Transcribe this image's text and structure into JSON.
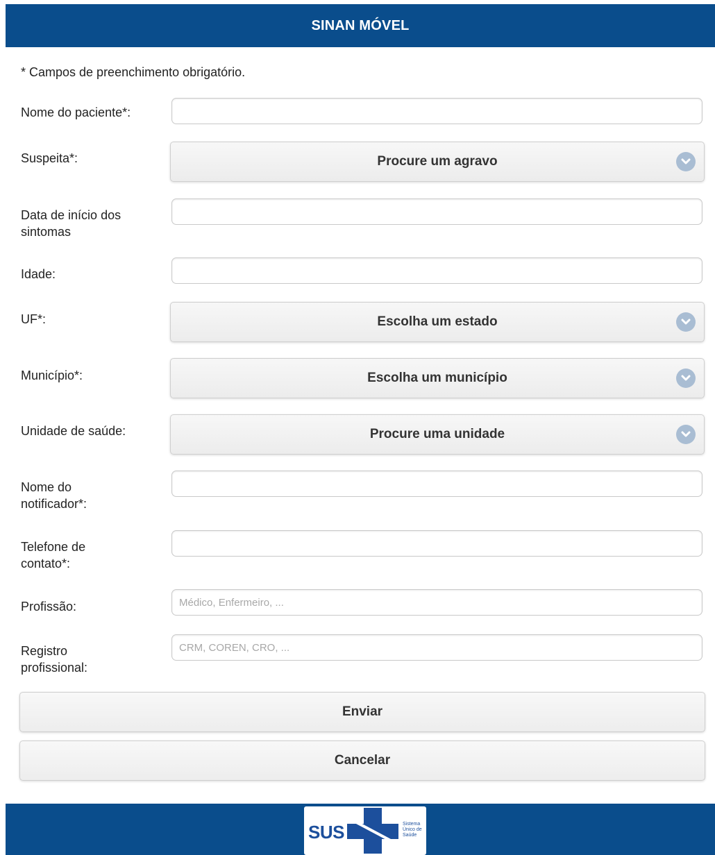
{
  "header": {
    "title": "SINAN MÓVEL"
  },
  "form": {
    "required_note": "* Campos de preenchimento obrigatório.",
    "patient_name": {
      "label": "Nome do paciente*:",
      "value": ""
    },
    "suspicion": {
      "label": "Suspeita*:",
      "selected": "Procure um agravo"
    },
    "symptom_start_date": {
      "label": "Data de início dos sintomas",
      "value": ""
    },
    "age": {
      "label": "Idade:",
      "value": ""
    },
    "state": {
      "label": "UF*:",
      "selected": "Escolha um estado"
    },
    "municipality": {
      "label": "Município*:",
      "selected": "Escolha um município"
    },
    "health_unit": {
      "label": "Unidade de saúde:",
      "selected": "Procure uma unidade"
    },
    "notifier_name": {
      "label": "Nome do notificador*:",
      "value": ""
    },
    "contact_phone": {
      "label": "Telefone de contato*:",
      "value": ""
    },
    "profession": {
      "label": "Profissão:",
      "placeholder": "Médico, Enfermeiro, ..."
    },
    "professional_registry": {
      "label": "Registro profissional:",
      "placeholder": "CRM, COREN, CRO, ..."
    }
  },
  "actions": {
    "submit": "Enviar",
    "cancel": "Cancelar"
  },
  "footer": {
    "logo": {
      "name": "SUS",
      "caption": "Sistema Único de Saúde"
    }
  },
  "colors": {
    "brand": "#0a4d8c",
    "chevron": "#a9bdd3"
  },
  "icons": {
    "select_indicator": "chevron-down-icon"
  }
}
